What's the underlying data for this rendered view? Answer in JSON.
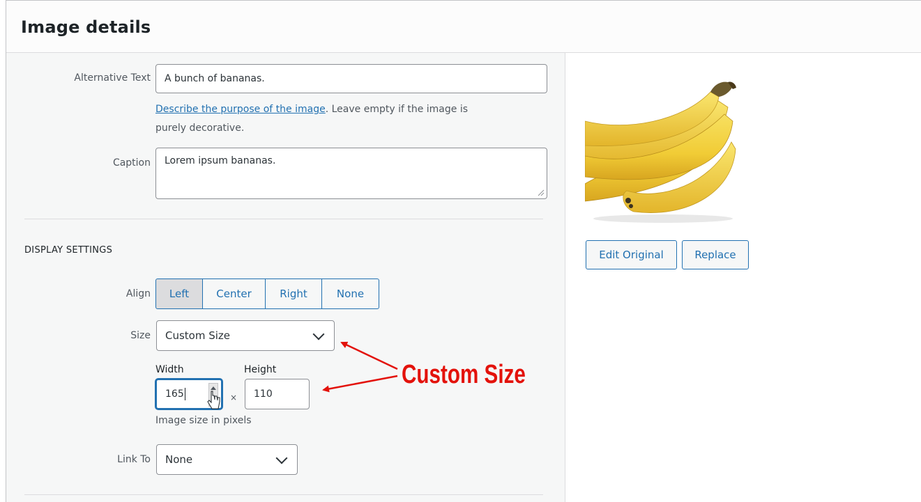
{
  "dialog": {
    "title": "Image details"
  },
  "fields": {
    "alt_text": {
      "label": "Alternative Text",
      "value": "A bunch of bananas.",
      "help_link": "Describe the purpose of the image",
      "help_text_1": ". Leave empty if the image is",
      "help_text_2": "purely decorative."
    },
    "caption": {
      "label": "Caption",
      "value": "Lorem ipsum bananas."
    }
  },
  "display_settings": {
    "title": "DISPLAY SETTINGS",
    "align": {
      "label": "Align",
      "options": [
        "Left",
        "Center",
        "Right",
        "None"
      ],
      "selected": "Left"
    },
    "size": {
      "label": "Size",
      "value": "Custom Size"
    },
    "custom": {
      "width_label": "Width",
      "width_value": "165",
      "height_label": "Height",
      "height_value": "110",
      "separator": "×",
      "hint": "Image size in pixels"
    },
    "link_to": {
      "label": "Link To",
      "value": "None"
    }
  },
  "preview": {
    "image": "banana-image",
    "buttons": [
      "Edit Original",
      "Replace"
    ]
  },
  "annotation": {
    "text": "Custom Size",
    "color": "#e3120b"
  },
  "colors": {
    "accent": "#2271b1",
    "panel": "#f6f7f7"
  }
}
